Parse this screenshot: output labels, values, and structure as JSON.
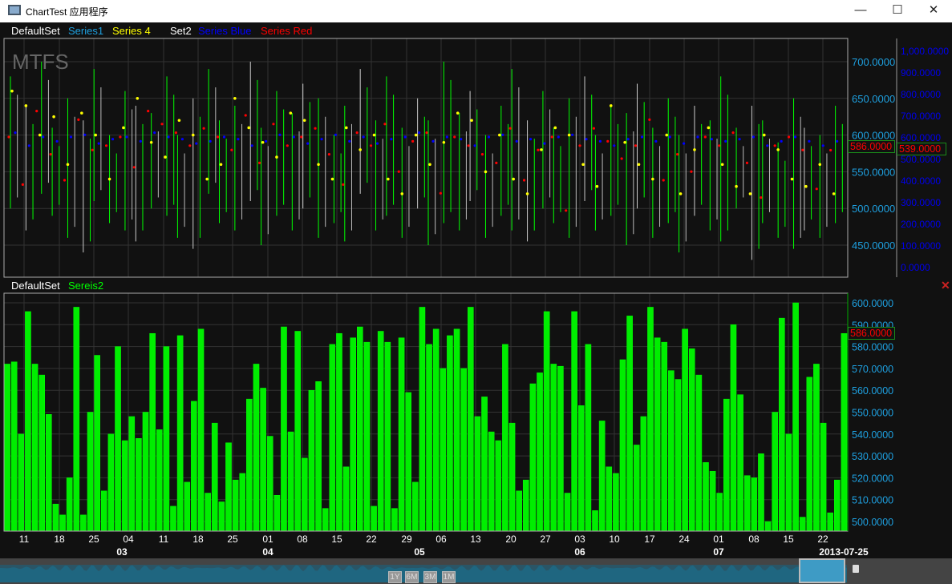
{
  "window": {
    "title": "ChartTest 应用程序",
    "minimize": "—",
    "maximize": "☐",
    "close": "✕"
  },
  "upper_legend": {
    "set1": "DefaultSet",
    "s1": "Series1",
    "s4": "Series 4",
    "set2": "Set2",
    "sblue": "Series Blue",
    "sred": "Series Red"
  },
  "watermark": "MTFS",
  "lower_legend": {
    "set": "DefaultSet",
    "s2": "Sereis2"
  },
  "close_panel": "✕",
  "colors": {
    "green": "#00ff00",
    "yellow": "#ffff00",
    "blue": "#0000ff",
    "red": "#ff0000",
    "cyan": "#1ea0e0"
  },
  "markers": {
    "upper_left": "586.0000",
    "upper_right": "539.0000",
    "lower": "586.0000"
  },
  "range_buttons": [
    "1Y",
    "6M",
    "3M",
    "1M"
  ],
  "chart_data": [
    {
      "type": "line",
      "title": "Upper panel",
      "left_axis": {
        "ticks": [
          "700.0000",
          "650.0000",
          "600.0000",
          "550.0000",
          "500.0000",
          "450.0000"
        ],
        "values": [
          700,
          650,
          600,
          550,
          500,
          450
        ]
      },
      "right_axis": {
        "ticks": [
          "1,000.0000",
          "900.0000",
          "800.0000",
          "700.0000",
          "600.0000",
          "500.0000",
          "400.0000",
          "300.0000",
          "200.0000",
          "100.0000",
          "0.0000"
        ],
        "values": [
          1000,
          900,
          800,
          700,
          600,
          500,
          400,
          300,
          200,
          100,
          0
        ]
      },
      "series1_hilo": [
        [
          500,
          680
        ],
        [
          470,
          640
        ],
        [
          520,
          700
        ],
        [
          490,
          610
        ],
        [
          460,
          650
        ],
        [
          440,
          620
        ],
        [
          510,
          690
        ],
        [
          480,
          600
        ],
        [
          470,
          660
        ],
        [
          455,
          640
        ],
        [
          500,
          630
        ],
        [
          490,
          680
        ],
        [
          460,
          600
        ],
        [
          445,
          650
        ],
        [
          520,
          690
        ],
        [
          480,
          620
        ],
        [
          470,
          640
        ],
        [
          510,
          700
        ],
        [
          450,
          610
        ],
        [
          490,
          660
        ],
        [
          470,
          630
        ],
        [
          500,
          670
        ],
        [
          460,
          650
        ],
        [
          480,
          600
        ],
        [
          455,
          640
        ],
        [
          520,
          690
        ],
        [
          470,
          620
        ],
        [
          490,
          680
        ],
        [
          460,
          610
        ],
        [
          500,
          650
        ],
        [
          450,
          620
        ],
        [
          480,
          700
        ],
        [
          470,
          630
        ],
        [
          510,
          660
        ],
        [
          460,
          600
        ],
        [
          490,
          640
        ],
        [
          470,
          690
        ],
        [
          455,
          620
        ],
        [
          500,
          660
        ],
        [
          480,
          610
        ],
        [
          460,
          650
        ],
        [
          510,
          680
        ],
        [
          470,
          600
        ],
        [
          490,
          640
        ],
        [
          450,
          630
        ],
        [
          500,
          670
        ],
        [
          460,
          610
        ],
        [
          480,
          650
        ],
        [
          440,
          600
        ],
        [
          490,
          640
        ],
        [
          470,
          620
        ],
        [
          455,
          680
        ],
        [
          500,
          610
        ],
        [
          430,
          640
        ],
        [
          480,
          620
        ],
        [
          460,
          590
        ],
        [
          445,
          650
        ],
        [
          470,
          610
        ],
        [
          460,
          600
        ],
        [
          480,
          640
        ]
      ],
      "series4": [
        660,
        640,
        600,
        625,
        560,
        630,
        600,
        540,
        610,
        650,
        590,
        570,
        620,
        600,
        540,
        560,
        650,
        610,
        590,
        570,
        630,
        620,
        560,
        540,
        610,
        580,
        600,
        540,
        520,
        600,
        560,
        590,
        630,
        620,
        550,
        600,
        540,
        520,
        580,
        610,
        600,
        560,
        530,
        640,
        590,
        560,
        540,
        600,
        520,
        580,
        610,
        560,
        530,
        520,
        600,
        580,
        540,
        530,
        560,
        520
      ],
      "series_blue": [
        620,
        560,
        600,
        580,
        600,
        610,
        570,
        590,
        600,
        580,
        620,
        600,
        590,
        570,
        580,
        600,
        590,
        560,
        580,
        610,
        600,
        570,
        590,
        610,
        580,
        600,
        570,
        590,
        600,
        620,
        580,
        600,
        590,
        560,
        600,
        610,
        580,
        590,
        570,
        600,
        610,
        590,
        580,
        560,
        590,
        600,
        580,
        600,
        570,
        600,
        590,
        580,
        590,
        600,
        560,
        580,
        600,
        580,
        560,
        580
      ],
      "series_red": [
        600,
        380,
        720,
        520,
        400,
        680,
        540,
        560,
        600,
        460,
        720,
        660,
        620,
        560,
        640,
        600,
        540,
        700,
        480,
        660,
        560,
        600,
        640,
        520,
        380,
        620,
        560,
        660,
        440,
        580,
        620,
        340,
        600,
        560,
        520,
        480,
        640,
        400,
        540,
        600,
        260,
        560,
        640,
        580,
        500,
        560,
        680,
        400,
        520,
        440,
        600,
        560,
        620,
        480,
        320,
        560,
        600,
        540,
        360,
        539
      ]
    },
    {
      "type": "bar",
      "title": "Lower panel",
      "series": "Sereis2",
      "ylim": [
        496,
        604
      ],
      "y_ticks": [
        "600.0000",
        "590.0000",
        "580.0000",
        "570.0000",
        "560.0000",
        "550.0000",
        "540.0000",
        "530.0000",
        "520.0000",
        "510.0000",
        "500.0000"
      ],
      "y_values": [
        600,
        590,
        580,
        570,
        560,
        550,
        540,
        530,
        520,
        510,
        500
      ],
      "values": [
        572,
        573,
        540,
        596,
        572,
        567,
        549,
        508,
        503,
        520,
        598,
        503,
        550,
        576,
        514,
        540,
        580,
        537,
        548,
        538,
        550,
        586,
        542,
        580,
        507,
        585,
        518,
        555,
        588,
        513,
        545,
        509,
        536,
        519,
        522,
        556,
        572,
        561,
        539,
        512,
        589,
        541,
        587,
        529,
        560,
        564,
        506,
        581,
        586,
        525,
        584,
        589,
        582,
        507,
        587,
        582,
        506,
        584,
        559,
        518,
        598,
        581,
        588,
        570,
        585,
        588,
        570,
        598,
        548,
        557,
        541,
        537,
        581,
        545,
        514,
        519,
        563,
        568,
        596,
        572,
        571,
        513,
        596,
        553,
        581,
        505,
        546,
        525,
        522,
        574,
        594,
        535,
        548,
        598,
        584,
        582,
        569,
        565,
        588,
        579,
        567,
        527,
        523,
        513,
        556,
        590,
        558,
        521,
        520,
        531,
        500,
        550,
        593,
        540,
        600,
        502,
        566,
        572,
        545,
        504,
        519,
        586
      ]
    },
    {
      "type": "axis",
      "x_day_ticks": [
        "11",
        "18",
        "25",
        "04",
        "11",
        "18",
        "25",
        "01",
        "08",
        "15",
        "22",
        "29",
        "06",
        "13",
        "20",
        "27",
        "03",
        "10",
        "17",
        "24",
        "01",
        "08",
        "15",
        "22"
      ],
      "x_month_ticks": [
        "03",
        "04",
        "05",
        "06",
        "07"
      ],
      "current_date": "2013-07-25"
    }
  ]
}
